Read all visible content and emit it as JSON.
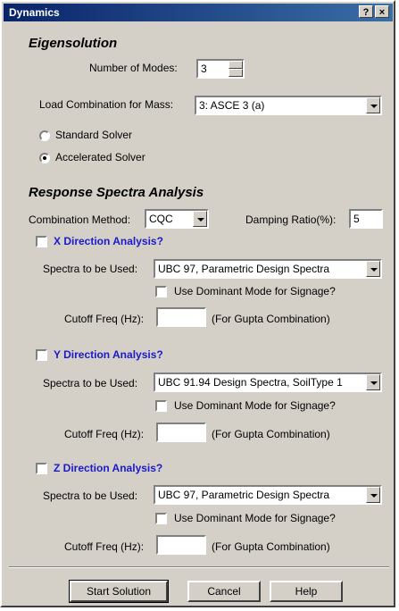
{
  "window": {
    "title": "Dynamics",
    "help_btn": "?",
    "close_btn": "×"
  },
  "eigen": {
    "heading": "Eigensolution",
    "num_modes_label": "Number of Modes:",
    "num_modes_value": "3",
    "load_combo_label": "Load Combination for Mass:",
    "load_combo_value": "3: ASCE 3 (a)",
    "standard_solver": "Standard Solver",
    "accelerated_solver": "Accelerated Solver",
    "selected_solver": "accelerated"
  },
  "rsa": {
    "heading": "Response Spectra Analysis",
    "combination_label": "Combination Method:",
    "combination_value": "CQC",
    "damping_label": "Damping Ratio(%):",
    "damping_value": "5",
    "x": {
      "label": "X Direction Analysis?",
      "spectra_label": "Spectra to be Used:",
      "spectra_value": "UBC 97, Parametric Design Spectra",
      "dominant_label": "Use Dominant Mode for Signage?",
      "cutoff_label": "Cutoff Freq (Hz):",
      "cutoff_value": "",
      "gupta_note": "(For Gupta Combination)"
    },
    "y": {
      "label": "Y Direction Analysis?",
      "spectra_label": "Spectra to be Used:",
      "spectra_value": "UBC 91.94 Design Spectra, SoilType 1",
      "dominant_label": "Use Dominant Mode for Signage?",
      "cutoff_label": "Cutoff Freq (Hz):",
      "cutoff_value": "",
      "gupta_note": "(For Gupta Combination)"
    },
    "z": {
      "label": "Z Direction Analysis?",
      "spectra_label": "Spectra to be Used:",
      "spectra_value": "UBC 97, Parametric Design Spectra",
      "dominant_label": "Use Dominant Mode for Signage?",
      "cutoff_label": "Cutoff Freq (Hz):",
      "cutoff_value": "",
      "gupta_note": "(For Gupta Combination)"
    }
  },
  "buttons": {
    "start": "Start Solution",
    "cancel": "Cancel",
    "help": "Help"
  }
}
